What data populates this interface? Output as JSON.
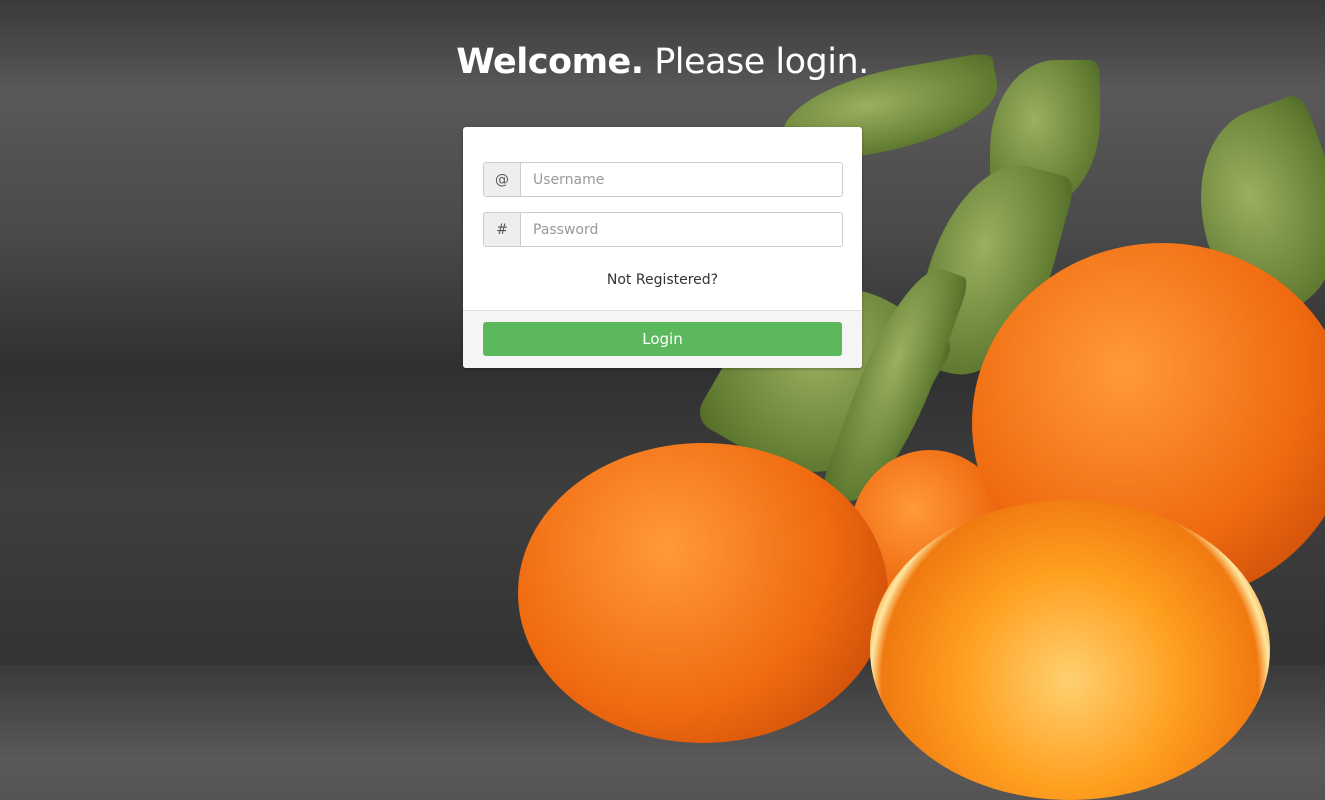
{
  "header": {
    "title_bold": "Welcome.",
    "title_rest": " Please login."
  },
  "form": {
    "username": {
      "addon": "@",
      "placeholder": "Username",
      "value": ""
    },
    "password": {
      "addon": "#",
      "placeholder": "Password",
      "value": ""
    },
    "register_link": "Not Registered?",
    "login_button": "Login"
  },
  "colors": {
    "login_button": "#5cb85c",
    "background": "#3a3a3a"
  }
}
